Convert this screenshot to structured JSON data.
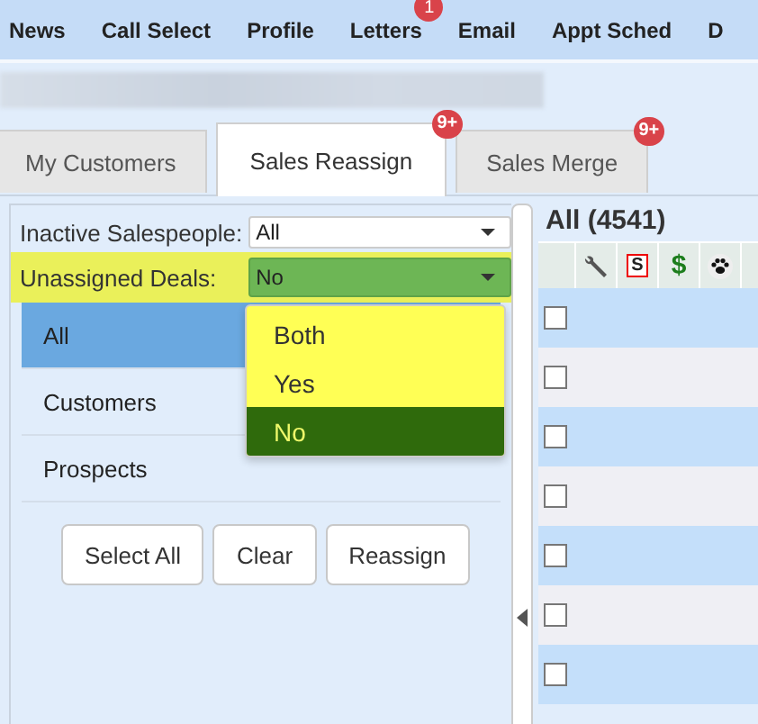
{
  "nav": {
    "items": [
      {
        "label": "News"
      },
      {
        "label": "Call Select"
      },
      {
        "label": "Profile"
      },
      {
        "label": "Letters",
        "badge": "1"
      },
      {
        "label": "Email"
      },
      {
        "label": "Appt Sched"
      },
      {
        "label": "D"
      }
    ]
  },
  "tabs": [
    {
      "label": "My Customers",
      "selected": false
    },
    {
      "label": "Sales Reassign",
      "selected": true,
      "badge": "9+"
    },
    {
      "label": "Sales Merge",
      "selected": false,
      "badge": "9+"
    }
  ],
  "filters": [
    {
      "label": "Inactive Salespeople:",
      "value": "All",
      "highlighted": false
    },
    {
      "label": "Unassigned Deals:",
      "value": "No",
      "highlighted": true
    }
  ],
  "dropdown": {
    "options": [
      {
        "label": "Both",
        "selected": false
      },
      {
        "label": "Yes",
        "selected": false
      },
      {
        "label": "No",
        "selected": true
      }
    ]
  },
  "list": [
    {
      "label": "All",
      "selected": true
    },
    {
      "label": "Customers",
      "selected": false
    },
    {
      "label": "Prospects",
      "selected": false
    }
  ],
  "buttons": [
    "Select All",
    "Clear",
    "Reassign"
  ],
  "grid": {
    "title": "All (4541)",
    "columns": [
      {
        "kind": "wrench"
      },
      {
        "kind": "boxed",
        "text": "S"
      },
      {
        "kind": "glyph",
        "text": "$"
      },
      {
        "kind": "paw"
      }
    ],
    "rows": [
      {
        "checked": false
      },
      {
        "checked": false
      },
      {
        "checked": false
      },
      {
        "checked": false
      },
      {
        "checked": false
      },
      {
        "checked": false
      },
      {
        "checked": false
      }
    ]
  }
}
